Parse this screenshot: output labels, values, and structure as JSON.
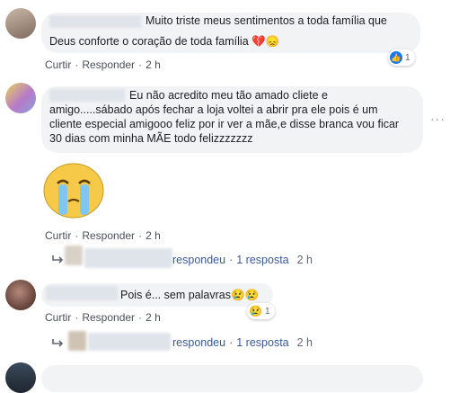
{
  "comments": [
    {
      "text_line1": "Muito triste meus sentimentos a toda família que",
      "text_line2": "Deus conforte o coração de toda família 💔😞",
      "like_label": "Curtir",
      "reply_label": "Responder",
      "time": "2 h",
      "reaction_count": "1"
    },
    {
      "text_line1": "Eu não acredito meu tão amado cliete e",
      "text_line2": "amigo.....sábado após fechar a loja voltei a abrir pra ele pois é um",
      "text_line3": "cliente especial amigooo feliz por ir ver a mãe,e disse branca vou ficar",
      "text_line4": "30 dias com minha MÃE todo felizzzzzzz",
      "like_label": "Curtir",
      "reply_label": "Responder",
      "time": "2 h",
      "reply_summary": {
        "responded": "respondeu",
        "count": "1 resposta",
        "time": "2 h"
      }
    },
    {
      "text": "Pois é... sem palavras😢😢",
      "like_label": "Curtir",
      "reply_label": "Responder",
      "time": "2 h",
      "reaction_count": "1",
      "reply_summary": {
        "responded": "respondeu",
        "count": "1 resposta",
        "time": "2 h"
      }
    }
  ],
  "separator": "·",
  "more_options": "···",
  "icons": {
    "like": "like-icon",
    "crying": "crying-face-icon",
    "reply_arrow": "reply-arrow-icon",
    "more": "more-options-icon"
  },
  "colors": {
    "bubble": "#f2f3f5",
    "link": "#385898",
    "meta": "#606770",
    "like_blue": "#1877f2"
  }
}
